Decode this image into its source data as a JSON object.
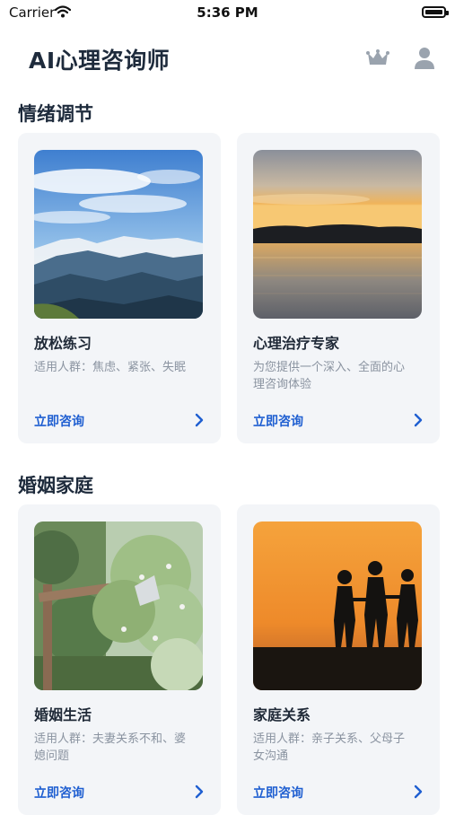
{
  "status_bar": {
    "carrier": "Carrier",
    "time": "5:36 PM"
  },
  "header": {
    "title": "AI心理咨询师",
    "icons": [
      "crown-icon",
      "user-icon"
    ]
  },
  "sections": [
    {
      "title": "情绪调节",
      "cards": [
        {
          "title": "放松练习",
          "description": "适用人群：焦虑、紧张、失眠",
          "cta": "立即咨询",
          "image": "mountain-landscape-image"
        },
        {
          "title": "心理治疗专家",
          "description": "为您提供一个深入、全面的心理咨询体验",
          "cta": "立即咨询",
          "image": "lake-sunset-image"
        }
      ]
    },
    {
      "title": "婚姻家庭",
      "cards": [
        {
          "title": "婚姻生活",
          "description": "适用人群：夫妻关系不和、婆媳问题",
          "cta": "立即咨询",
          "image": "wedding-flowers-image"
        },
        {
          "title": "家庭关系",
          "description": "适用人群：亲子关系、父母子女沟通",
          "cta": "立即咨询",
          "image": "family-silhouette-image"
        }
      ]
    }
  ],
  "colors": {
    "accent": "#1f5fd1",
    "card_bg": "#f3f5f8",
    "title_text": "#1e2b3c",
    "muted_text": "#8a93a0",
    "icon_gray": "#9aa3ae"
  }
}
